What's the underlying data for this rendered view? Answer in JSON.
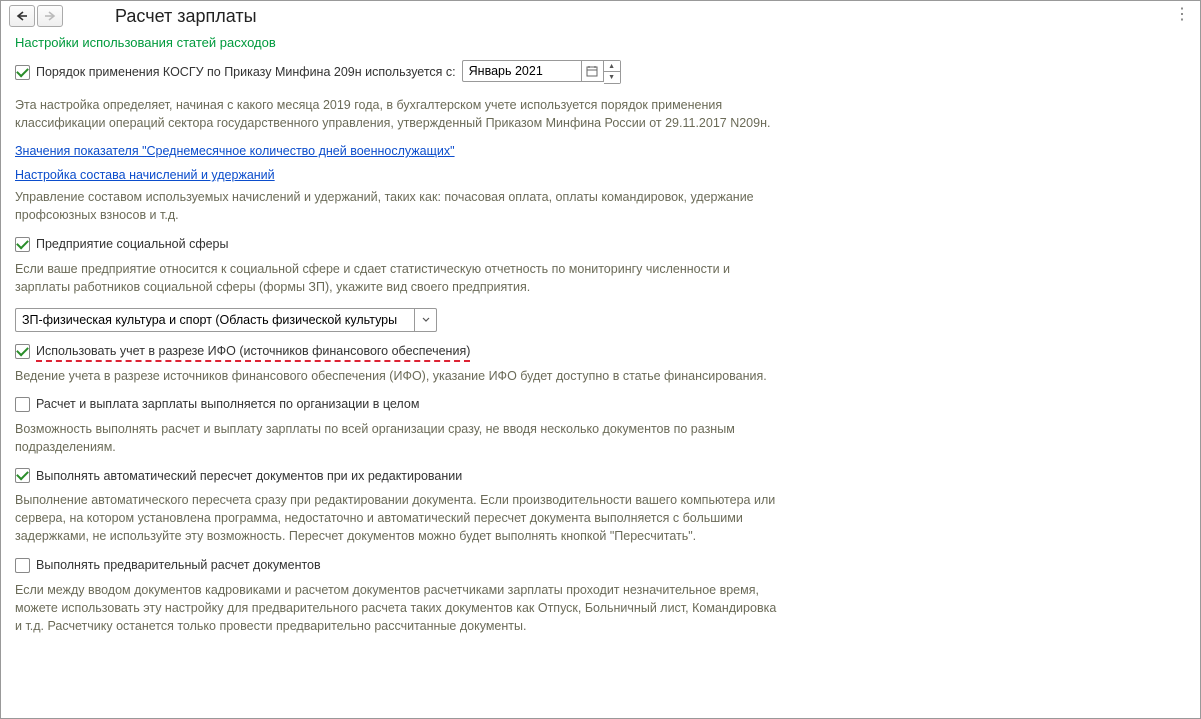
{
  "header": {
    "title": "Расчет зарплаты"
  },
  "section_title": "Настройки использования статей расходов",
  "kosgu": {
    "label": "Порядок применения КОСГУ по Приказу Минфина 209н используется с:",
    "date_value": "Январь 2021",
    "desc": "Эта настройка определяет, начиная с какого месяца 2019 года, в бухгалтерском учете используется порядок применения классификации операций сектора государственного управления, утвержденный Приказом Минфина России от 29.11.2017 N209н."
  },
  "link_indicators": "Значения показателя \"Среднемесячное количество дней военнослужащих\"",
  "link_accruals": "Настройка состава начислений и удержаний",
  "accruals_desc": "Управление составом используемых начислений и удержаний, таких как: почасовая оплата, оплаты командировок, удержание профсоюзных взносов и т.д.",
  "social_enterprise": {
    "label": "Предприятие социальной сферы",
    "desc": "Если ваше предприятие относится к социальной сфере и сдает статистическую отчетность по мониторингу численности и зарплаты работников социальной сферы (формы ЗП), укажите вид своего предприятия.",
    "select_value": "ЗП-физическая культура и спорт (Область физической культуры"
  },
  "ifo": {
    "label": "Использовать учет в разрезе ИФО (источников финансового обеспечения)",
    "desc": "Ведение учета в разрезе источников финансового обеспечения (ИФО), указание ИФО будет доступно в статье финансирования."
  },
  "org_whole": {
    "label": "Расчет и выплата зарплаты выполняется по организации в целом",
    "desc": "Возможность выполнять расчет и выплату зарплаты по всей организации сразу, не вводя несколько документов по разным подразделениям."
  },
  "autorecalc": {
    "label": "Выполнять автоматический пересчет документов при их редактировании",
    "desc": "Выполнение автоматического пересчета сразу при редактировании документа. Если производительности вашего компьютера или сервера, на котором установлена программа, недостаточно и автоматический пересчет документа выполняется с большими задержками, не используйте эту возможность. Пересчет документов можно будет выполнять кнопкой \"Пересчитать\"."
  },
  "precalc": {
    "label": "Выполнять предварительный расчет документов",
    "desc": "Если между вводом документов кадровиками и расчетом документов расчетчиками зарплаты проходит незначительное время, можете использовать эту настройку для предварительного расчета таких документов как Отпуск, Больничный лист, Командировка и т.д. Расчетчику останется только провести предварительно рассчитанные документы."
  }
}
